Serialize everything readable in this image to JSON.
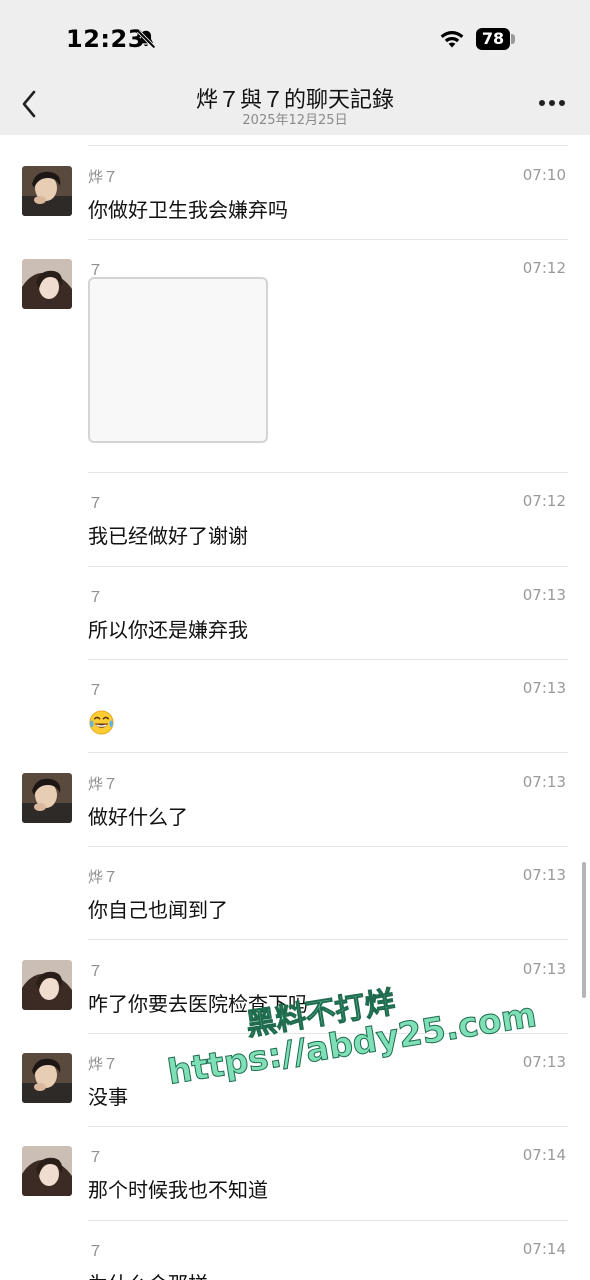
{
  "status_bar": {
    "time": "12:23",
    "battery": "78"
  },
  "header": {
    "title": "烨７與７的聊天記錄",
    "subtitle": "2025年12月25日"
  },
  "messages": [
    {
      "sender": "烨７",
      "time": "07:10",
      "text": "你做好卫生我会嫌弃吗",
      "type": "text",
      "avatar": "male"
    },
    {
      "sender": "７",
      "time": "07:12",
      "text": "",
      "type": "image",
      "avatar": "female"
    },
    {
      "sender": "７",
      "time": "07:12",
      "text": "我已经做好了谢谢",
      "type": "text",
      "avatar": ""
    },
    {
      "sender": "７",
      "time": "07:13",
      "text": "所以你还是嫌弃我",
      "type": "text",
      "avatar": ""
    },
    {
      "sender": "７",
      "time": "07:13",
      "text": "",
      "type": "emoji",
      "emoji": "tears-of-joy-emoji",
      "avatar": ""
    },
    {
      "sender": "烨７",
      "time": "07:13",
      "text": "做好什么了",
      "type": "text",
      "avatar": "male"
    },
    {
      "sender": "烨７",
      "time": "07:13",
      "text": "你自己也闻到了",
      "type": "text",
      "avatar": ""
    },
    {
      "sender": "７",
      "time": "07:13",
      "text": "咋了你要去医院检查下吗",
      "type": "text",
      "avatar": "female"
    },
    {
      "sender": "烨７",
      "time": "07:13",
      "text": "没事",
      "type": "text",
      "avatar": "male"
    },
    {
      "sender": "７",
      "time": "07:14",
      "text": "那个时候我也不知道",
      "type": "text",
      "avatar": "female"
    },
    {
      "sender": "７",
      "time": "07:14",
      "text": "为什么会那样",
      "type": "text",
      "avatar": ""
    }
  ],
  "watermark": {
    "line1": "黑料不打烊",
    "line2": "https://abdy25.com"
  },
  "colors": {
    "header_bg": "#eeeeee",
    "divider": "#e6e6e6",
    "meta_text": "#8f8f8f",
    "watermark": "#7fe0b7"
  }
}
